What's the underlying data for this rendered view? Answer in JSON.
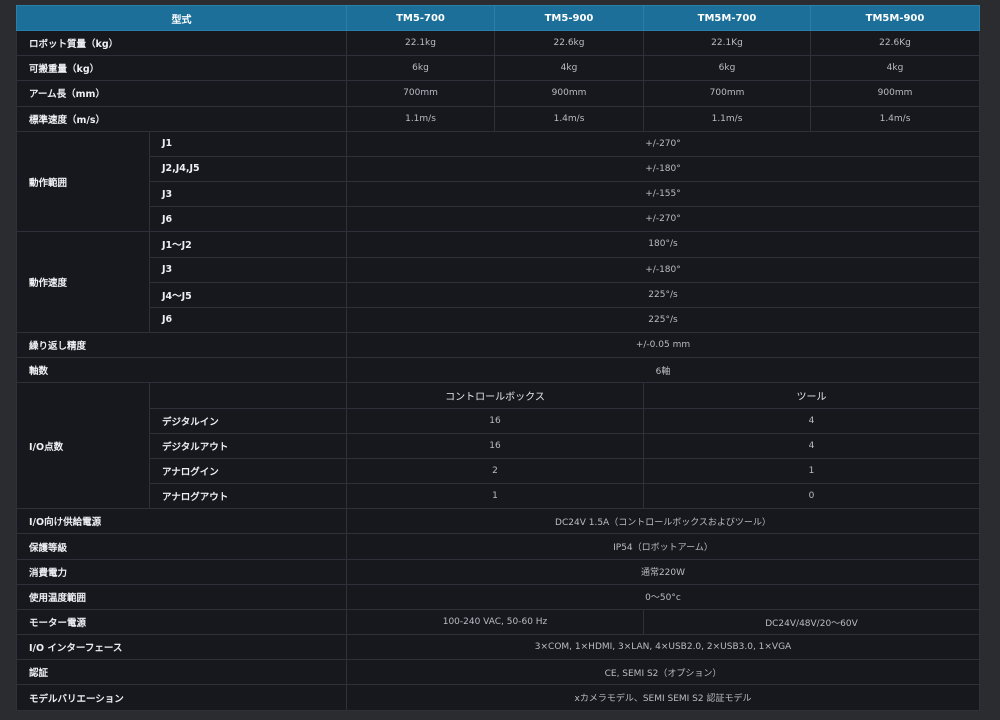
{
  "header": [
    "型式",
    "TM5-700",
    "TM5-900",
    "TM5M-700",
    "TM5M-900"
  ],
  "robot_weight": {
    "label": "ロボット質量（kg）",
    "values": [
      "22.1kg",
      "22.6kg",
      "22.1Kg",
      "22.6Kg"
    ]
  },
  "payload": {
    "label": "可搬重量（kg）",
    "values": [
      "6kg",
      "4kg",
      "6kg",
      "4kg"
    ]
  },
  "arm_length": {
    "label": "アーム長（mm）",
    "values": [
      "700mm",
      "900mm",
      "700mm",
      "900mm"
    ]
  },
  "std_speed": {
    "label": "標準速度（m/s）",
    "values": [
      "1.1m/s",
      "1.4m/s",
      "1.1m/s",
      "1.4m/s"
    ]
  },
  "motion_range": {
    "label": "動作範囲",
    "rows": [
      {
        "joint": "J1",
        "value": "+/-270°"
      },
      {
        "joint": "J2,J4,J5",
        "value": "+/-180°"
      },
      {
        "joint": "J3",
        "value": "+/-155°"
      },
      {
        "joint": "J6",
        "value": "+/-270°"
      }
    ]
  },
  "motion_speed": {
    "label": "動作速度",
    "rows": [
      {
        "joint": "J1～J2",
        "value": "180°/s"
      },
      {
        "joint": "J3",
        "value": "+/-180°"
      },
      {
        "joint": "J4～J5",
        "value": "225°/s"
      },
      {
        "joint": "J6",
        "value": "225°/s"
      }
    ]
  },
  "repeatability": {
    "label": "繰り返し精度",
    "value": "+/-0.05 mm"
  },
  "axes": {
    "label": "軸数",
    "value": "6軸"
  },
  "io": {
    "label": "I/O点数",
    "col_controlbox": "コントロールボックス",
    "col_tool": "ツール",
    "rows": [
      {
        "name": "デジタルイン",
        "box": "16",
        "tool": "4"
      },
      {
        "name": "デジタルアウト",
        "box": "16",
        "tool": "4"
      },
      {
        "name": "アナログイン",
        "box": "2",
        "tool": "1"
      },
      {
        "name": "アナログアウト",
        "box": "1",
        "tool": "0"
      }
    ]
  },
  "io_power": {
    "label": "I/O向け供給電源",
    "value": "DC24V 1.5A（コントロールボックスおよびツール）"
  },
  "protection": {
    "label": "保護等級",
    "value": "IP54（ロボットアーム）"
  },
  "power_consumption": {
    "label": "消費電力",
    "value": "通常220W"
  },
  "temp_range": {
    "label": "使用温度範囲",
    "value": "0～50°c"
  },
  "motor_power": {
    "label": "モーター電源",
    "value_left": "100-240 VAC, 50-60 Hz",
    "value_right": "DC24V/48V/20～60V"
  },
  "io_interface": {
    "label": "I/O インターフェース",
    "value": "3×COM, 1×HDMI, 3×LAN, 4×USB2.0, 2×USB3.0, 1×VGA"
  },
  "certification": {
    "label": "認証",
    "value": "CE, SEMI S2（オプション）"
  },
  "model_variation": {
    "label": "モデルバリエーション",
    "value": "xカメラモデル、SEMI SEMI S2 認証モデル"
  },
  "colors": {
    "header_bg": "#1b6f99",
    "table_bg": "#17181d",
    "page_bg": "#2a2c30",
    "border": "#2e3139"
  }
}
